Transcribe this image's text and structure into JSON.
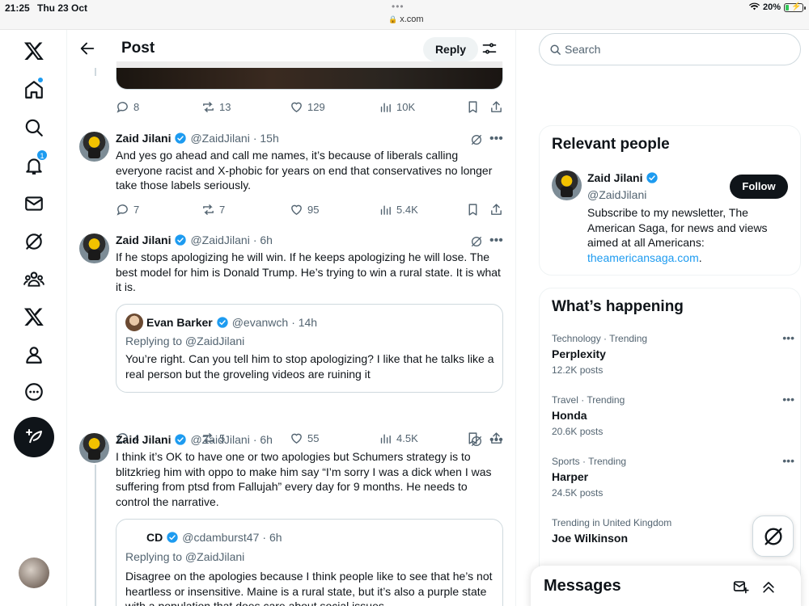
{
  "status_bar": {
    "time": "21:25",
    "date": "Thu 23 Oct",
    "url": "x.com",
    "battery": "20%",
    "battery_level": 0.2
  },
  "nav": {
    "notifications_badge": "1",
    "icons": [
      "x-logo-icon",
      "home-icon",
      "search-icon",
      "bell-icon",
      "mail-icon",
      "grok-icon",
      "communities-icon",
      "x-premium-icon",
      "profile-icon",
      "more-icon",
      "compose-icon"
    ]
  },
  "header": {
    "title": "Post",
    "reply_label": "Reply"
  },
  "top_actions": {
    "replies": "8",
    "reposts": "13",
    "likes": "129",
    "views": "10K"
  },
  "posts": [
    {
      "name": "Zaid Jilani",
      "handle": "@ZaidJilani",
      "time": "· 15h",
      "text": "And yes go ahead and call me names, it’s because of liberals calling everyone racist and X-phobic for years on end that conservatives no longer take those labels seriously.",
      "replies": "7",
      "reposts": "7",
      "likes": "95",
      "views": "5.4K"
    },
    {
      "name": "Zaid Jilani",
      "handle": "@ZaidJilani",
      "time": "· 6h",
      "text": "If he stops apologizing he will win. If he keeps apologizing he will lose. The best model for him is Donald Trump. He’s trying to win a rural state. It is what it is.",
      "quote": {
        "name": "Evan Barker",
        "handle": "@evanwch",
        "time": "· 14h",
        "replying": "Replying to @ZaidJilani",
        "text": "You’re right. Can you tell him to stop apologizing? I like that he talks like a real person but the groveling videos are ruining it"
      },
      "replies": "4",
      "reposts": "5",
      "likes": "55",
      "views": "4.5K"
    },
    {
      "name": "Zaid Jilani",
      "handle": "@ZaidJilani",
      "time": "· 6h",
      "text": "I think it’s OK to have one or two apologies but Schumers strategy is to blitzkrieg him with oppo to make him say “I’m sorry I was a dick when I was suffering from ptsd from Fallujah” every day for 9 months. He needs to control the narrative.",
      "quote": {
        "name": "CD",
        "handle": "@cdamburst47",
        "time": "· 6h",
        "replying": "Replying to @ZaidJilani",
        "text": "Disagree on the apologies because I think people like to see that he’s not heartless or insensitive. Maine is a rural state, but it’s also a purple state with a population that does care about social issues."
      }
    }
  ],
  "search": {
    "placeholder": "Search"
  },
  "relevant_people": {
    "title": "Relevant people",
    "name": "Zaid Jilani",
    "handle": "@ZaidJilani",
    "follow_label": "Follow",
    "bio": "Subscribe to my newsletter, The American Saga, for news and views aimed at all Americans: ",
    "bio_link": "theamericansaga.com",
    "bio_end": "."
  },
  "whats_happening": {
    "title": "What’s happening",
    "trends": [
      {
        "meta": "Technology · Trending",
        "name": "Perplexity",
        "count": "12.2K posts"
      },
      {
        "meta": "Travel · Trending",
        "name": "Honda",
        "count": "20.6K posts"
      },
      {
        "meta": "Sports · Trending",
        "name": "Harper",
        "count": "24.5K posts"
      },
      {
        "meta": "Trending in United Kingdom",
        "name": "Joe Wilkinson",
        "count": ""
      }
    ]
  },
  "messages": {
    "title": "Messages"
  },
  "colors": {
    "accent": "#1d9bf0",
    "text": "#0f1419",
    "muted": "#536471"
  }
}
